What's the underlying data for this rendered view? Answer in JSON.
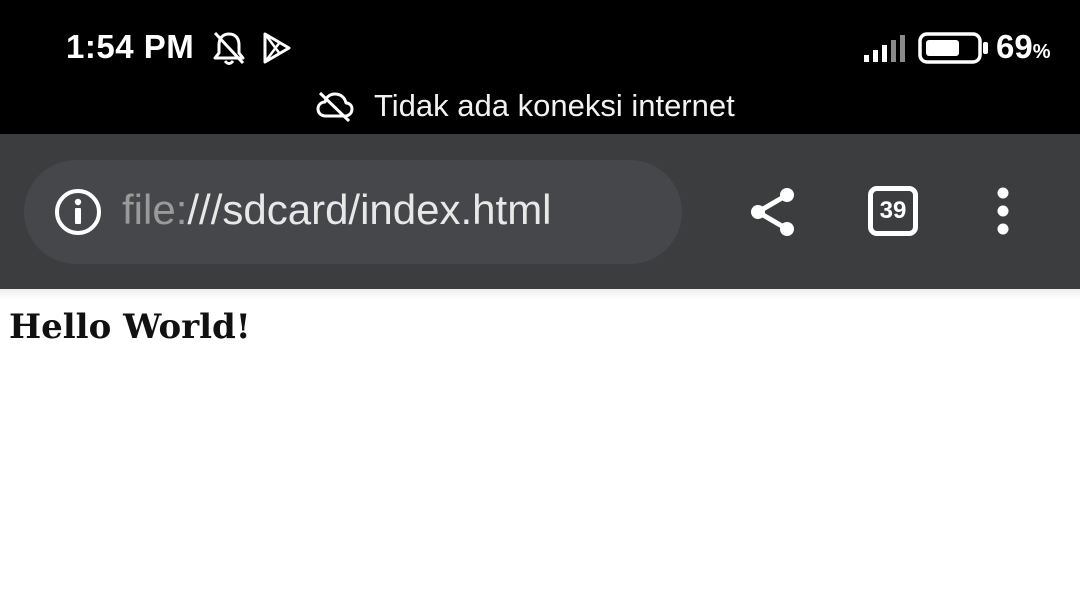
{
  "status_bar": {
    "time": "1:54 PM",
    "icons": [
      "bell-muted-icon",
      "play-store-icon",
      "signal-icon",
      "battery-icon"
    ],
    "battery_percent": "69",
    "battery_percent_sign": "%",
    "battery_level": 0.69
  },
  "offline_notice": {
    "icon": "cloud-off-icon",
    "text": "Tidak ada koneksi internet"
  },
  "toolbar": {
    "url_scheme": "file:",
    "url_rest": "///sdcard/index.html",
    "tab_count": "39",
    "icons": [
      "info-icon",
      "share-icon",
      "tabs-icon",
      "more-vert-icon"
    ]
  },
  "page": {
    "heading": "Hello World!"
  },
  "colors": {
    "status_bar_bg": "#000000",
    "toolbar_bg": "#3c3d3f",
    "url_pill_bg": "#46474a",
    "page_bg": "#ffffff"
  }
}
